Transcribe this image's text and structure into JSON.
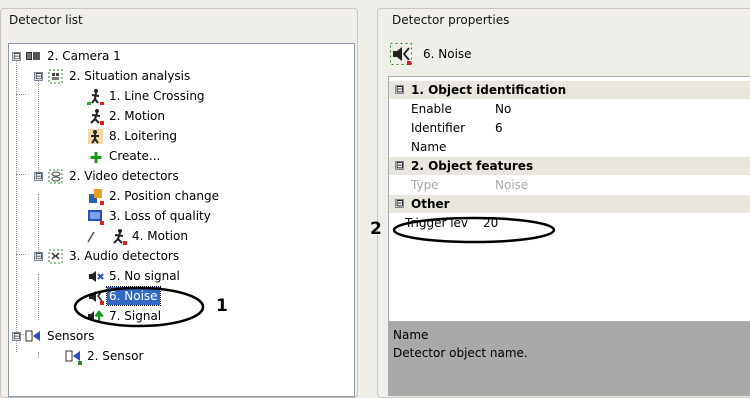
{
  "left_panel": {
    "title": "Detector list",
    "tree": [
      {
        "label": "2. Camera 1",
        "icon": "camera-icon"
      },
      {
        "label": "2. Situation analysis",
        "icon": "situation-analysis-icon"
      },
      {
        "label": "1. Line Crossing",
        "icon": "line-crossing-icon"
      },
      {
        "label": "2. Motion",
        "icon": "motion-icon"
      },
      {
        "label": "8. Loitering",
        "icon": "loitering-icon"
      },
      {
        "label": "Create...",
        "icon": "plus-icon"
      },
      {
        "label": "2. Video detectors",
        "icon": "video-detectors-icon"
      },
      {
        "label": "2. Position change",
        "icon": "position-change-icon"
      },
      {
        "label": "3. Loss of quality",
        "icon": "loss-of-quality-icon"
      },
      {
        "label": "4. Motion",
        "icon": "motion-icon"
      },
      {
        "label": "3. Audio detectors",
        "icon": "audio-detectors-icon"
      },
      {
        "label": "5. No signal",
        "icon": "no-signal-icon"
      },
      {
        "label": "6. Noise",
        "icon": "noise-icon"
      },
      {
        "label": "7. Signal",
        "icon": "signal-icon"
      },
      {
        "label": "Sensors",
        "icon": "sensors-icon"
      },
      {
        "label": "2. Sensor",
        "icon": "sensor-icon"
      }
    ],
    "expander_symbol": "⊟"
  },
  "right_panel": {
    "title": "Detector properties",
    "selected_name": "6. Noise",
    "sections": [
      {
        "title": "1. Object identification",
        "rows": [
          {
            "key": "Enable",
            "value": "No"
          },
          {
            "key": "Identifier",
            "value": "6"
          },
          {
            "key": "Name",
            "value": ""
          }
        ]
      },
      {
        "title": "2. Object features",
        "rows": [
          {
            "key": "Type",
            "value": "Noise"
          }
        ]
      },
      {
        "title": "Other",
        "rows": [
          {
            "key": "Trigger lev",
            "value": "20"
          }
        ]
      }
    ],
    "description": {
      "title": "Name",
      "text": "Detector object name."
    }
  },
  "callouts": {
    "one": "1",
    "two": "2"
  },
  "colors": {
    "selection": "#316ac5",
    "description_bg": "#a9a9a9",
    "section_bg": "#e9e6dd"
  }
}
